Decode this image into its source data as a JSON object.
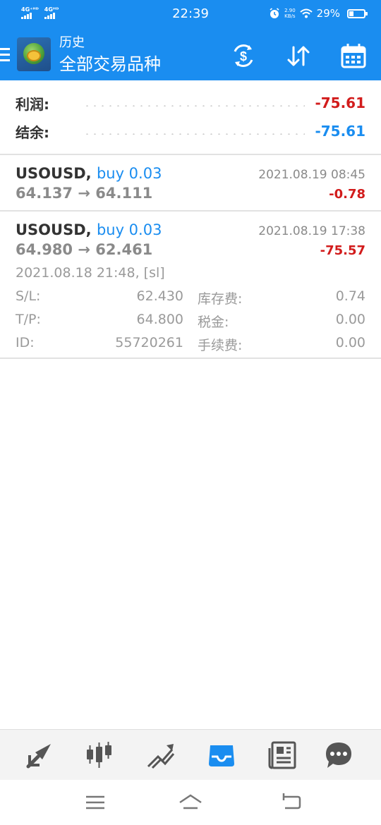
{
  "status_bar": {
    "network_1": "4G⁺ᴴᴰ",
    "network_2": "4Gᴴᴰ",
    "time": "22:39",
    "speed_value": "2.90",
    "speed_unit": "KB/s",
    "battery": "29%",
    "battery_level": 0.29
  },
  "app_bar": {
    "title": "历史",
    "subtitle": "全部交易品种",
    "icons": [
      "menu-icon",
      "app-logo",
      "currency-exchange-icon",
      "sort-icon",
      "calendar-icon"
    ],
    "accent_color": "#1a8df0"
  },
  "summary": {
    "profit_label": "利润:",
    "profit_value": "-75.61",
    "balance_label": "结余:",
    "balance_value": "-75.61"
  },
  "deals": [
    {
      "symbol": "USOUSD,",
      "side": "buy 0.03",
      "prices": "64.137 → 64.111",
      "time": "2021.08.19 08:45",
      "profit": "-0.78"
    },
    {
      "symbol": "USOUSD,",
      "side": "buy 0.03",
      "prices": "64.980 → 62.461",
      "time": "2021.08.19 17:38",
      "profit": "-75.57",
      "details": {
        "open_info": "2021.08.18 21:48, [sl]",
        "sl_label": "S/L:",
        "sl_value": "62.430",
        "swap_label": "库存费:",
        "swap_value": "0.74",
        "tp_label": "T/P:",
        "tp_value": "64.800",
        "tax_label": "税金:",
        "tax_value": "0.00",
        "id_label": "ID:",
        "id_value": "55720261",
        "commission_label": "手续费:",
        "commission_value": "0.00"
      }
    }
  ],
  "tab_bar": {
    "tabs": [
      "quotes-icon",
      "chart-icon",
      "trade-icon",
      "history-icon",
      "news-icon",
      "chat-icon"
    ],
    "active": "history-icon",
    "active_color": "#1a8df0",
    "inactive_color": "#555555"
  },
  "nav_bar": {
    "buttons": [
      "recent-apps-icon",
      "home-icon",
      "back-icon"
    ]
  }
}
